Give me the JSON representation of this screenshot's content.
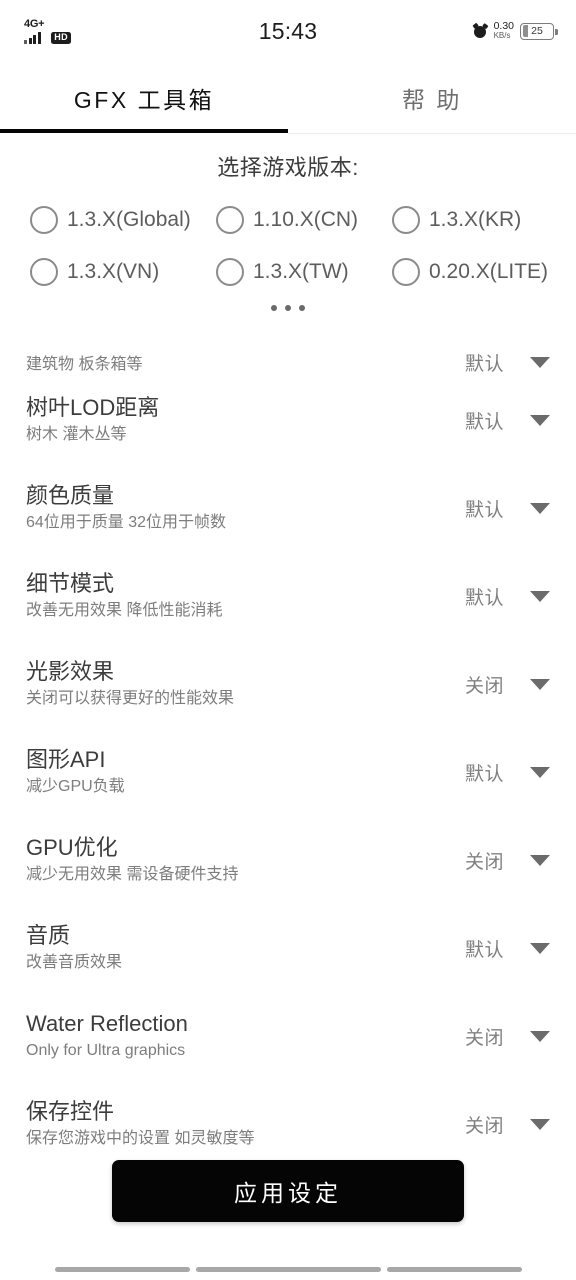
{
  "status_bar": {
    "network_generation": "4G+",
    "hd_badge": "HD",
    "clock": "15:43",
    "net_speed_value": "0.30",
    "net_speed_unit": "KB/s",
    "battery_level": "25"
  },
  "tabs": [
    {
      "label": "GFX 工具箱",
      "active": true
    },
    {
      "label": "帮 助",
      "active": false
    }
  ],
  "version_selector": {
    "title": "选择游戏版本:",
    "options": [
      {
        "label": "1.3.X(Global)",
        "selected": false
      },
      {
        "label": "1.10.X(CN)",
        "selected": false
      },
      {
        "label": "1.3.X(KR)",
        "selected": false
      },
      {
        "label": "1.3.X(VN)",
        "selected": false
      },
      {
        "label": "1.3.X(TW)",
        "selected": false
      },
      {
        "label": "0.20.X(LITE)",
        "selected": false
      }
    ]
  },
  "settings": [
    {
      "title": "",
      "subtitle": "建筑物 板条箱等",
      "value": "默认",
      "clipped": true
    },
    {
      "title": "树叶LOD距离",
      "subtitle": "树木 灌木丛等",
      "value": "默认"
    },
    {
      "title": "颜色质量",
      "subtitle": "64位用于质量 32位用于帧数",
      "value": "默认"
    },
    {
      "title": "细节模式",
      "subtitle": "改善无用效果 降低性能消耗",
      "value": "默认"
    },
    {
      "title": "光影效果",
      "subtitle": "关闭可以获得更好的性能效果",
      "value": "关闭"
    },
    {
      "title": "图形API",
      "subtitle": "减少GPU负载",
      "value": "默认"
    },
    {
      "title": "GPU优化",
      "subtitle": "减少无用效果 需设备硬件支持",
      "value": "关闭"
    },
    {
      "title": "音质",
      "subtitle": "改善音质效果",
      "value": "默认"
    },
    {
      "title": "Water Reflection",
      "subtitle": "Only for Ultra graphics",
      "value": "关闭"
    },
    {
      "title": "保存控件",
      "subtitle": "保存您游戏中的设置 如灵敏度等",
      "value": "关闭"
    }
  ],
  "apply_button": {
    "label": "应用设定"
  },
  "colors": {
    "accent": "#050505",
    "title_text": "#3c3c3c",
    "subtitle_text": "#7d7d7d",
    "value_text": "#808080",
    "background": "#ffffff"
  }
}
